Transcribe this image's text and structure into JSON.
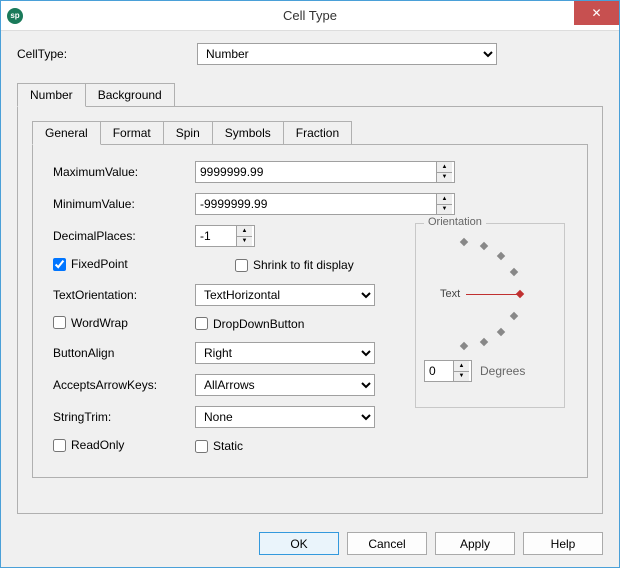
{
  "window": {
    "title": "Cell Type",
    "icon_text": "sp"
  },
  "cellType": {
    "label": "CellType:",
    "value": "Number"
  },
  "outerTabs": [
    {
      "label": "Number",
      "active": true
    },
    {
      "label": "Background",
      "active": false
    }
  ],
  "innerTabs": [
    {
      "label": "General",
      "active": true
    },
    {
      "label": "Format",
      "active": false
    },
    {
      "label": "Spin",
      "active": false
    },
    {
      "label": "Symbols",
      "active": false
    },
    {
      "label": "Fraction",
      "active": false
    }
  ],
  "fields": {
    "maxLabel": "MaximumValue:",
    "maxValue": "9999999.99",
    "minLabel": "MinimumValue:",
    "minValue": "-9999999.99",
    "decLabel": "DecimalPlaces:",
    "decValue": "-1",
    "fixedPointLabel": "FixedPoint",
    "fixedPointChecked": true,
    "shrinkLabel": "Shrink to fit display",
    "shrinkChecked": false,
    "textOrientLabel": "TextOrientation:",
    "textOrientValue": "TextHorizontal",
    "wordWrapLabel": "WordWrap",
    "wordWrapChecked": false,
    "dropDownLabel": "DropDownButton",
    "dropDownChecked": false,
    "buttonAlignLabel": "ButtonAlign",
    "buttonAlignValue": "Right",
    "arrowKeysLabel": "AcceptsArrowKeys:",
    "arrowKeysValue": "AllArrows",
    "stringTrimLabel": "StringTrim:",
    "stringTrimValue": "None",
    "readOnlyLabel": "ReadOnly",
    "readOnlyChecked": false,
    "staticLabel": "Static",
    "staticChecked": false
  },
  "orientation": {
    "legend": "Orientation",
    "text": "Text",
    "degreesLabel": "Degrees",
    "degreesValue": "0"
  },
  "buttons": {
    "ok": "OK",
    "cancel": "Cancel",
    "apply": "Apply",
    "help": "Help"
  }
}
